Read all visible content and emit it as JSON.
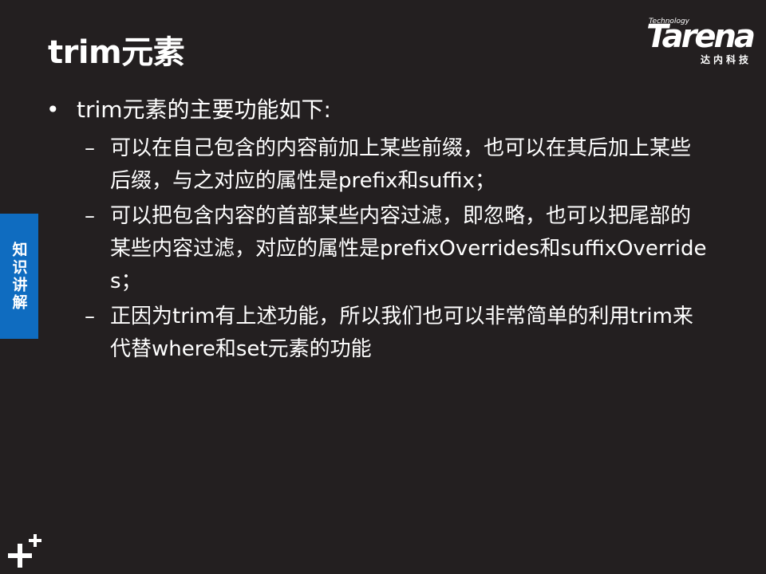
{
  "slide": {
    "title": "trim元素",
    "logo": {
      "word": "Tarena",
      "small": "Technology",
      "cn": "达内科技"
    },
    "side_tab": "知识讲解",
    "bullet": "trim元素的主要功能如下:",
    "sub_bullets": [
      "可以在自己包含的内容前加上某些前缀，也可以在其后加上某些后缀，与之对应的属性是prefix和suffix；",
      "可以把包含内容的首部某些内容过滤，即忽略，也可以把尾部的某些内容过滤，对应的属性是prefixOverrides和suffixOverrides；",
      "正因为trim有上述功能，所以我们也可以非常简单的利用trim来代替where和set元素的功能"
    ],
    "colors": {
      "background": "#231f20",
      "text": "#ffffff",
      "side_tab": "#0f6cc0"
    }
  }
}
